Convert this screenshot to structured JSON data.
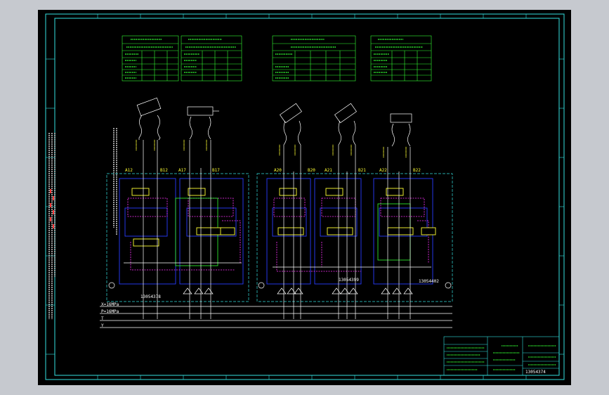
{
  "drawing": {
    "block_ids": [
      "13054378",
      "13054399",
      "13054402"
    ],
    "drawing_number": "13054374",
    "pressure_lines": [
      "X=16MPa",
      "P=16MPa",
      "T",
      "Y"
    ],
    "port_labels": [
      "A12",
      "B12",
      "A17",
      "B17",
      "A20",
      "B20",
      "A21",
      "B21",
      "A22",
      "B22"
    ]
  },
  "colors": {
    "background": "#000000",
    "frame": "#33e0e0",
    "tables": "#33ff33",
    "circuit_blue": "#2a3cff",
    "pilot_magenta": "#ff33ff",
    "main_white": "#ffffff",
    "valve_yellow": "#ffff33"
  }
}
